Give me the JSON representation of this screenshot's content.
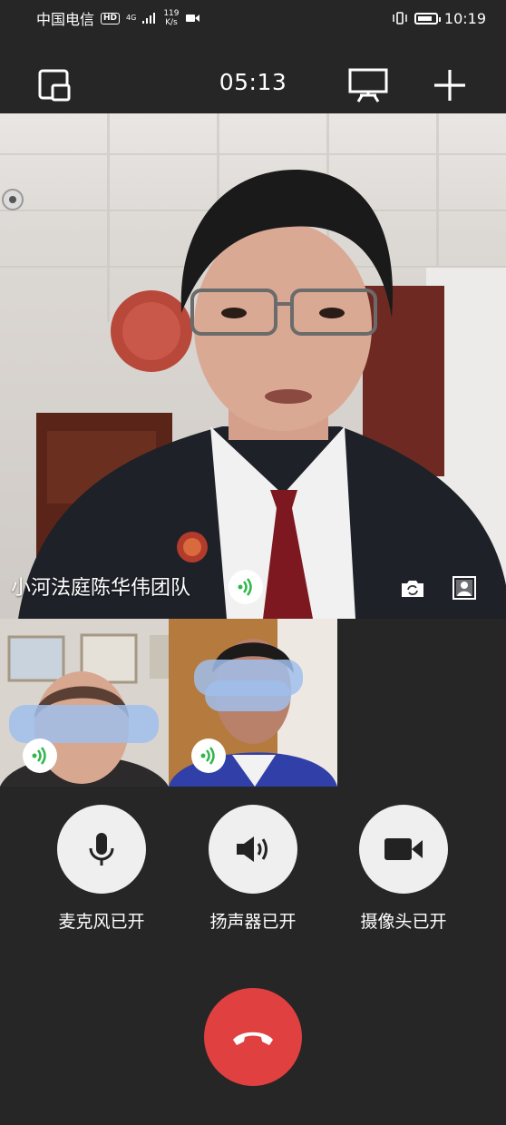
{
  "status_bar": {
    "carrier": "中国电信",
    "hd": "HD",
    "network": "4G",
    "speed_value": "119",
    "speed_unit": "K/s",
    "time": "10:19",
    "battery_level": 0.85
  },
  "call": {
    "timer": "05:13"
  },
  "main_participant": {
    "name": "小河法庭陈华伟团队"
  },
  "controls": {
    "mic_label": "麦克风已开",
    "speaker_label": "扬声器已开",
    "camera_label": "摄像头已开"
  },
  "colors": {
    "background": "#262626",
    "hangup": "#e0403f",
    "control_bg": "#efefef",
    "speaking_green": "#2fb74a"
  }
}
